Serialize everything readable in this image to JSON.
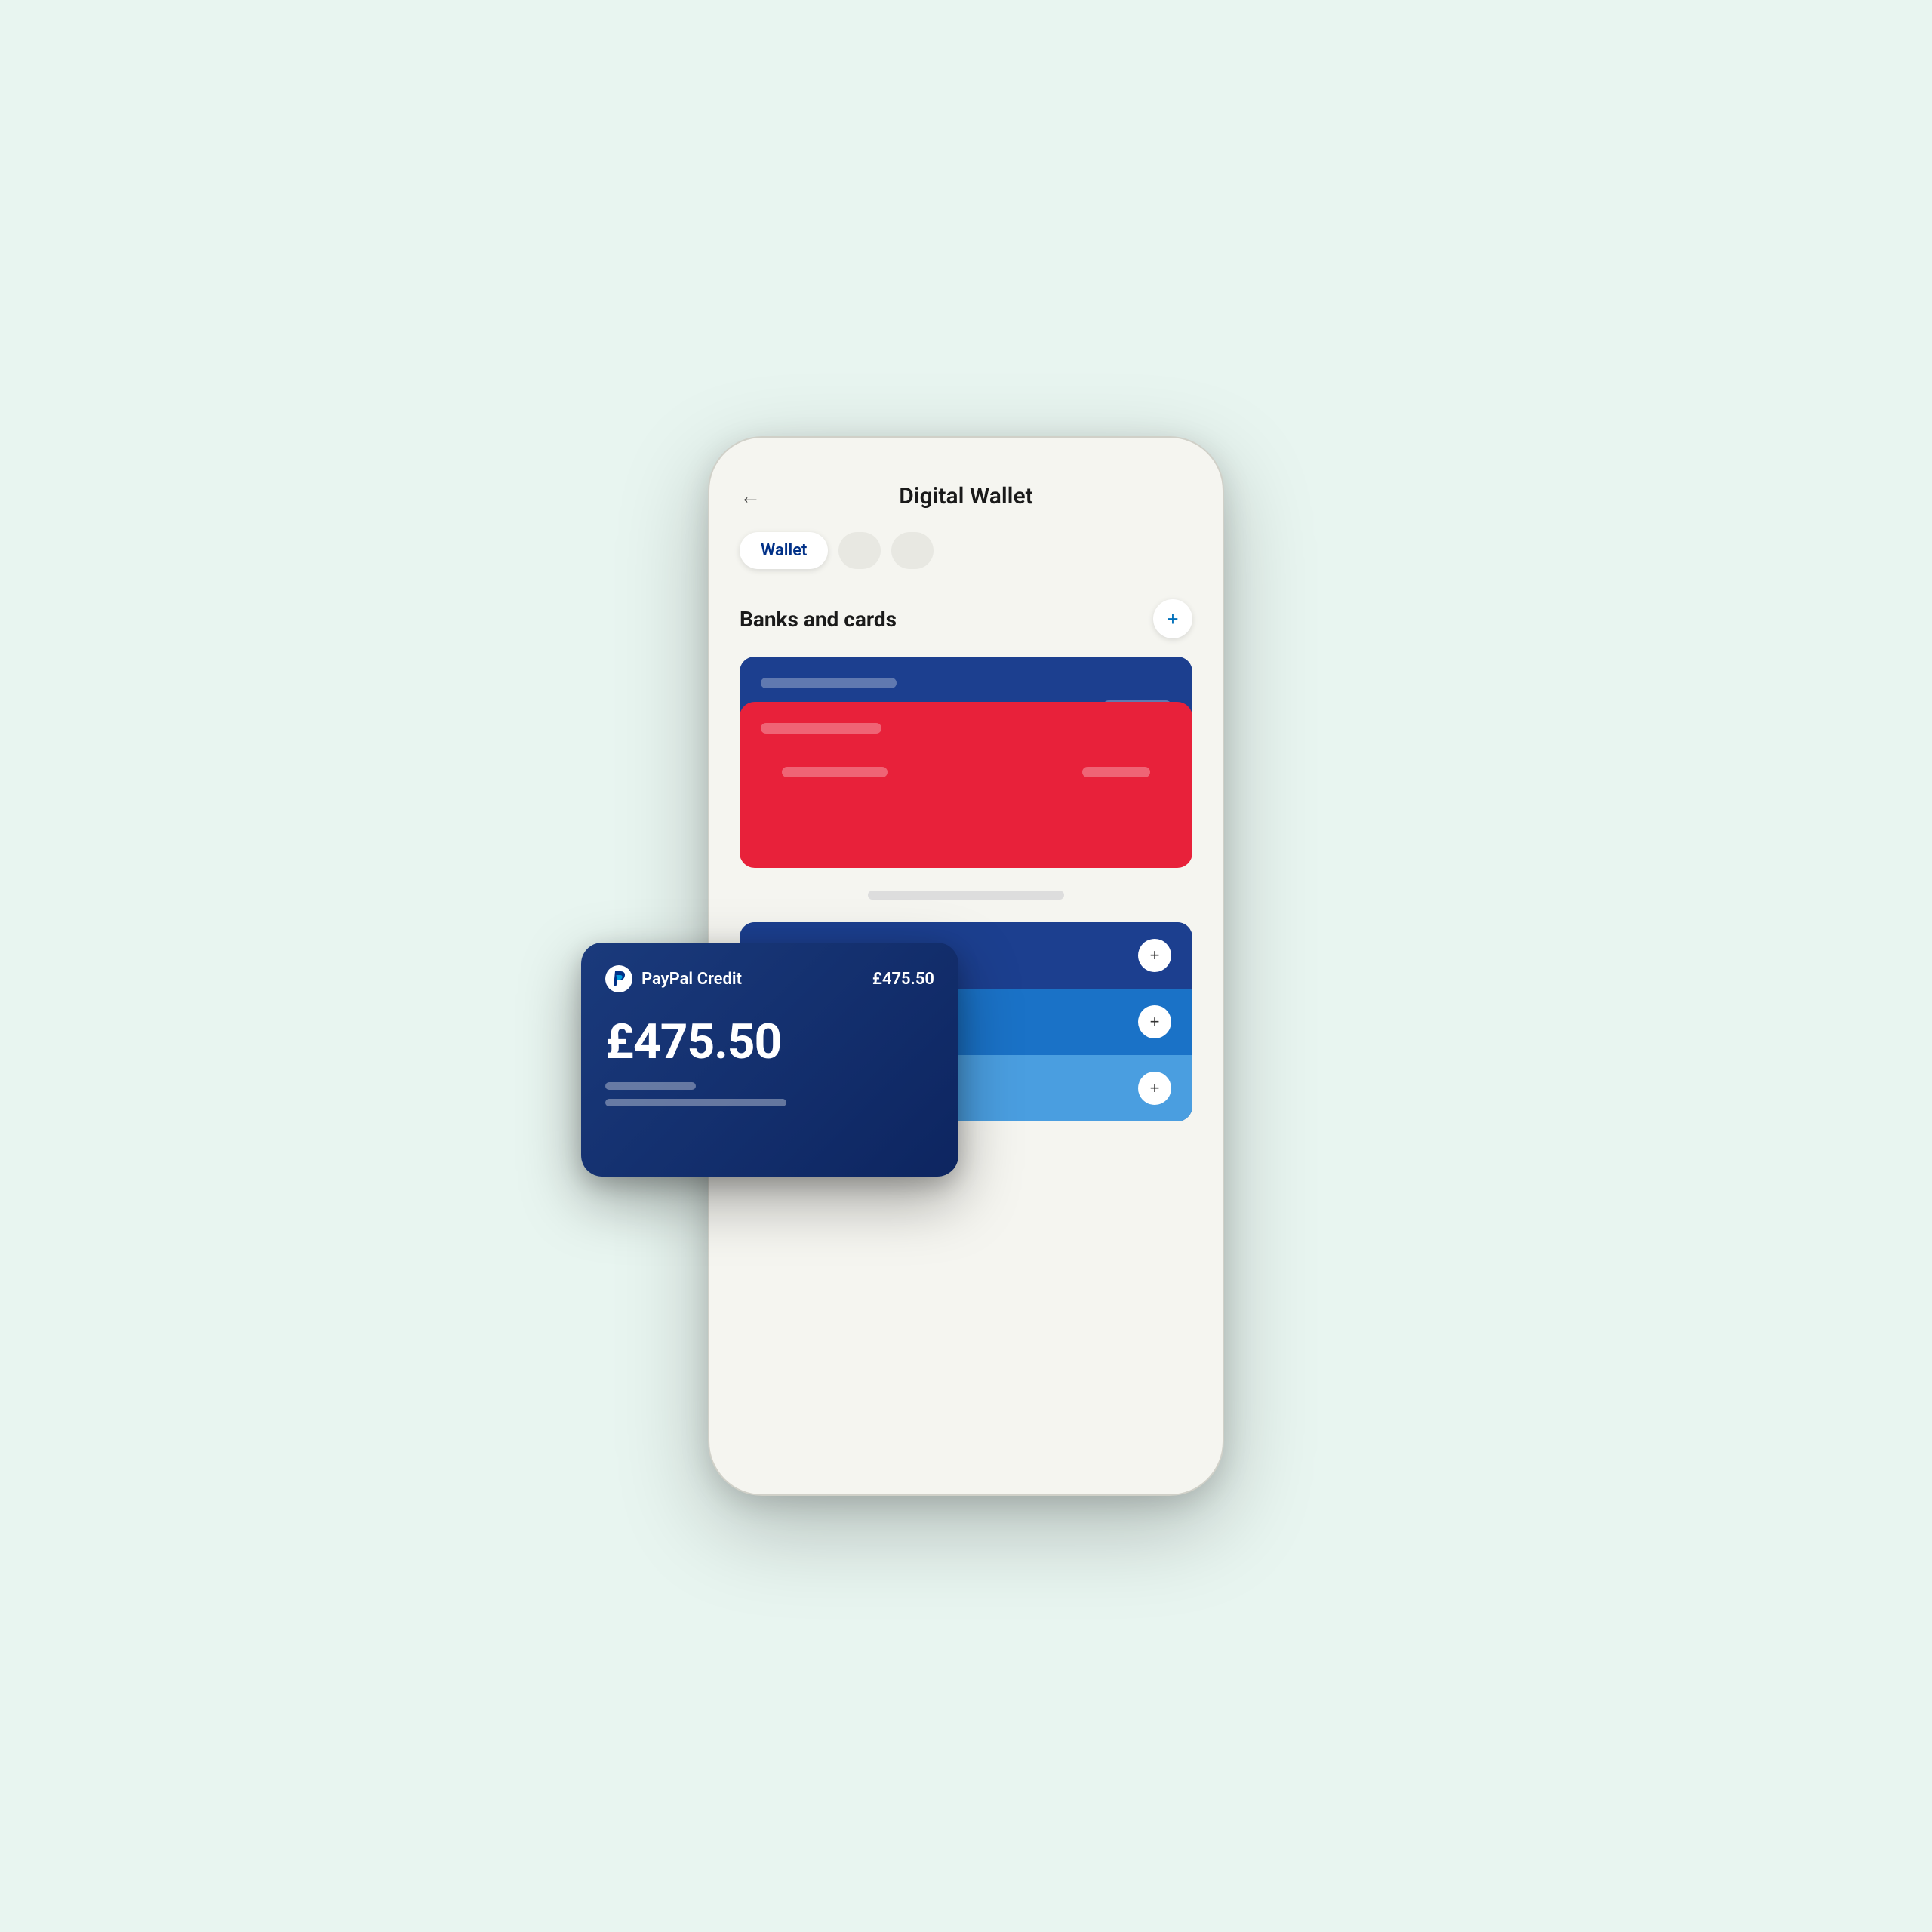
{
  "header": {
    "title": "Digital Wallet",
    "back_label": "←"
  },
  "tabs": [
    {
      "label": "Wallet",
      "active": true
    },
    {
      "label": "",
      "active": false
    },
    {
      "label": "",
      "active": false
    }
  ],
  "sections": {
    "banks_cards": {
      "title": "Banks and cards",
      "add_button_label": "+"
    }
  },
  "paypal_card": {
    "name": "PayPal Credit",
    "balance_top": "£475.50",
    "amount": "£475.50"
  },
  "methods": [
    {
      "add_label": "+"
    },
    {
      "add_label": "+"
    },
    {
      "add_label": "+"
    }
  ]
}
